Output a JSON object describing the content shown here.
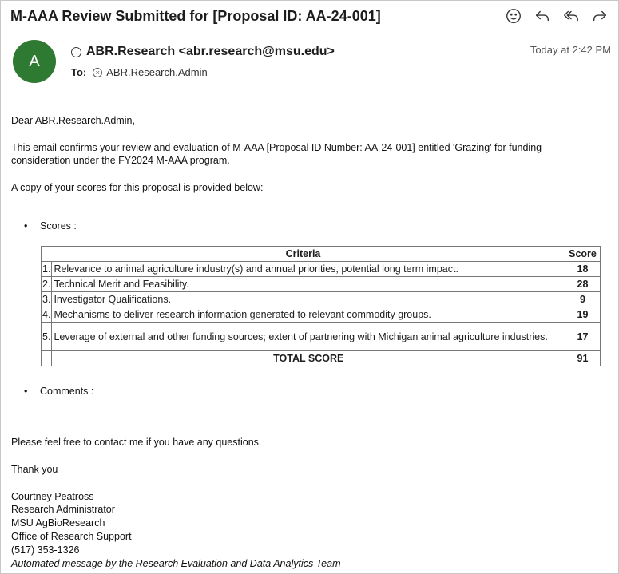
{
  "email": {
    "subject": "M-AAA Review Submitted for [Proposal ID: AA-24-001]",
    "avatar_letter": "A",
    "sender": "ABR.Research <abr.research@msu.edu>",
    "timestamp": "Today at 2:42 PM",
    "to_label": "To:",
    "recipient": "ABR.Research.Admin"
  },
  "actions": [
    {
      "icon": "emoji-icon"
    },
    {
      "icon": "reply-icon"
    },
    {
      "icon": "reply-all-icon"
    },
    {
      "icon": "forward-icon"
    }
  ],
  "body": {
    "greeting": "Dear ABR.Research.Admin,",
    "confirm_line1": "This email confirms your review and evaluation of M-AAA [Proposal ID Number: AA-24-001] entitled 'Grazing' for funding",
    "confirm_line2": "consideration under the FY2024 M-AAA program.",
    "copy_line": "A copy of your scores for this proposal is provided below:",
    "scores_label": "Scores :",
    "comments_label": "Comments :",
    "contact_line": "Please feel free to contact me if you have any questions.",
    "thanks": "Thank you"
  },
  "table": {
    "header_criteria": "Criteria",
    "header_score": "Score",
    "rows": [
      {
        "num": "1.",
        "criteria": "Relevance to animal agriculture industry(s) and annual priorities, potential long term impact.",
        "score": "18"
      },
      {
        "num": "2.",
        "criteria": "Technical Merit and Feasibility.",
        "score": "28"
      },
      {
        "num": "3.",
        "criteria": "Investigator Qualifications.",
        "score": "9"
      },
      {
        "num": "4.",
        "criteria": "Mechanisms to deliver research information generated to relevant commodity groups.",
        "score": "19"
      },
      {
        "num": "5.",
        "criteria": "Leverage of external and other funding sources; extent of partnering with Michigan animal agriculture industries.",
        "score": "17"
      }
    ],
    "total_label": "TOTAL SCORE",
    "total_score": "91"
  },
  "signature": {
    "name": "Courtney Peatross",
    "title": "Research Administrator",
    "org": "MSU AgBioResearch",
    "office": "Office of Research Support",
    "phone": "(517) 353-1326",
    "automated": "Automated message by the Research Evaluation and Data Analytics Team"
  }
}
